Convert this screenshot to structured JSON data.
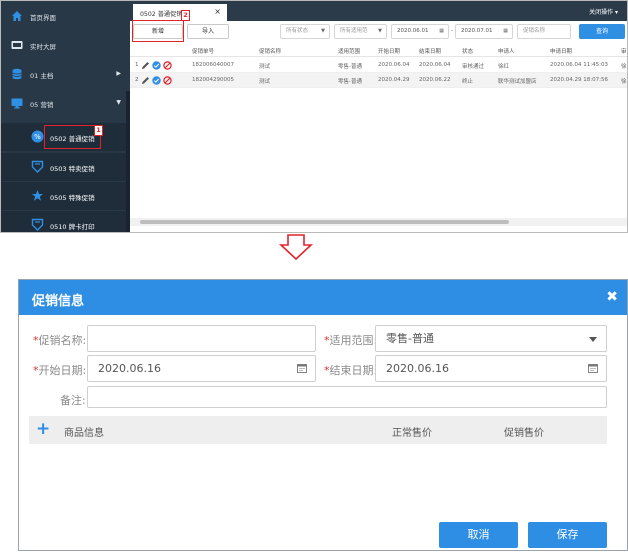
{
  "sidebar": {
    "items": [
      {
        "label": "首页界面",
        "icon": "home-icon",
        "arrow": ""
      },
      {
        "label": "实时大屏",
        "icon": "dashboard-icon",
        "arrow": ""
      },
      {
        "label": "01 主档",
        "icon": "database-icon",
        "arrow": "▶"
      },
      {
        "label": "05 营销",
        "icon": "monitor-icon",
        "arrow": "▼"
      }
    ],
    "subitems": [
      {
        "label": "0502 普通促销",
        "icon": "percent-tag-icon"
      },
      {
        "label": "0503 特卖促销",
        "icon": "shield-tag-icon"
      },
      {
        "label": "0505 特殊促销",
        "icon": "star-tag-icon"
      },
      {
        "label": "0510 牌卡打印",
        "icon": "shield-tag-icon"
      }
    ]
  },
  "header": {
    "tab_label": "0502 普通促销",
    "tab_close": "×",
    "ops_label": "关闭操作 ▾"
  },
  "toolbar": {
    "add_label": "新增",
    "import_label": "导入",
    "status_placeholder": "所有状态",
    "scope_placeholder": "所有适用范",
    "start_date": "2020.06.01",
    "end_date": "2020.07.01",
    "date_sep": "-",
    "name_placeholder": "促销名称",
    "query_label": "查询"
  },
  "grid": {
    "columns": [
      "促销单号",
      "促销名称",
      "适用范围",
      "开始日期",
      "结束日期",
      "状态",
      "申请人",
      "申请日期",
      "审"
    ],
    "rows": [
      {
        "num": "1",
        "no": "182006040007",
        "name": "测试",
        "scope": "零售-普通",
        "start": "2020.06.04",
        "end": "2020.06.04",
        "status": "审核通过",
        "applicant": "徐红",
        "date": "2020.06.04 11:45:03",
        "extra": "徐"
      },
      {
        "num": "2",
        "no": "182004290005",
        "name": "测试",
        "scope": "零售-普通",
        "start": "2020.04.29",
        "end": "2020.06.22",
        "status": "终止",
        "applicant": "联华测试加盟店",
        "date": "2020.04.29 18:07:56",
        "extra": "徐"
      }
    ]
  },
  "annotations": {
    "badge1": "1",
    "badge2": "2"
  },
  "dialog": {
    "title": "促销信息",
    "close": "✖",
    "required_mark": "*",
    "name_label": "促销名称:",
    "name_value": "",
    "scope_label": "适用范围:",
    "scope_value": "零售-普通",
    "start_label": "开始日期:",
    "start_value": "2020.06.16",
    "end_label": "结束日期:",
    "end_value": "2020.06.16",
    "note_label": "备注:",
    "note_value": "",
    "goods_add": "+",
    "goods_info": "商品信息",
    "regular_price": "正常售价",
    "promo_price": "促销售价",
    "cancel_label": "取消",
    "save_label": "保存"
  },
  "colors": {
    "sidebar_bg": "#293846",
    "accent_blue": "#2e8ee4",
    "annotation_red": "#e0232b",
    "required_red": "#e3312d"
  }
}
